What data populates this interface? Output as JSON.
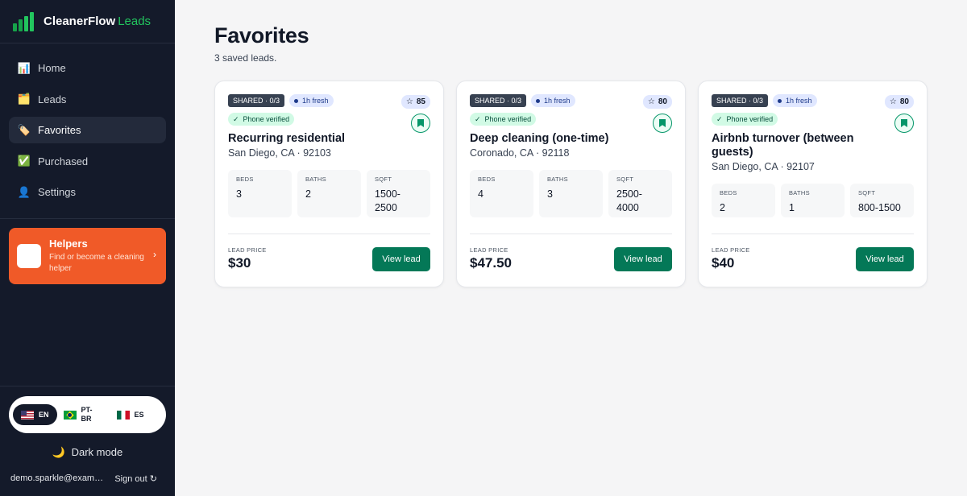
{
  "brand": {
    "name": "CleanerFlow",
    "accent": "Leads",
    "accent_color": "#22c55e"
  },
  "nav": {
    "items": [
      {
        "label": "Home",
        "icon": "chart-icon",
        "glyph": "📊"
      },
      {
        "label": "Leads",
        "icon": "box-icon",
        "glyph": "🗂️"
      },
      {
        "label": "Favorites",
        "icon": "tag-icon",
        "glyph": "🏷️",
        "active": true
      },
      {
        "label": "Purchased",
        "icon": "checkmark-icon",
        "glyph": "✅"
      },
      {
        "label": "Settings",
        "icon": "user-icon",
        "glyph": "👤"
      }
    ]
  },
  "helpers": {
    "title": "Helpers",
    "subtitle": "Find or become a cleaning helper",
    "chevron": "›",
    "bg_color": "#f05a28"
  },
  "language": {
    "options": [
      {
        "code": "EN",
        "flag": "us-flag-icon",
        "active": true
      },
      {
        "code": "PT-BR",
        "flag": "brazil-flag-icon",
        "active": false
      },
      {
        "code": "ES",
        "flag": "mexico-flag-icon",
        "active": false
      }
    ]
  },
  "dark_mode": {
    "label": "Dark mode",
    "icon": "moon-icon",
    "glyph": "🌙"
  },
  "account": {
    "email": "demo.sparkle@example.com",
    "sign_out": "Sign out",
    "sign_out_glyph": "↻"
  },
  "page": {
    "title": "Favorites",
    "subtitle": "3 saved leads."
  },
  "cards": [
    {
      "shared": "SHARED · 0/3",
      "fresh": "1h fresh",
      "score": "85",
      "verified": "Phone verified",
      "title": "Recurring residential",
      "location": "San Diego, CA · 92103",
      "beds_label": "BEDS",
      "beds": "3",
      "baths_label": "BATHS",
      "baths": "2",
      "sqft_label": "SQFT",
      "sqft": "1500-2500",
      "price_label": "LEAD PRICE",
      "price": "$30",
      "button": "View lead"
    },
    {
      "shared": "SHARED · 0/3",
      "fresh": "1h fresh",
      "score": "80",
      "verified": "Phone verified",
      "title": "Deep cleaning (one-time)",
      "location": "Coronado, CA · 92118",
      "beds_label": "BEDS",
      "beds": "4",
      "baths_label": "BATHS",
      "baths": "3",
      "sqft_label": "SQFT",
      "sqft": "2500-4000",
      "price_label": "LEAD PRICE",
      "price": "$47.50",
      "button": "View lead"
    },
    {
      "shared": "SHARED · 0/3",
      "fresh": "1h fresh",
      "score": "80",
      "verified": "Phone verified",
      "title": "Airbnb turnover (between guests)",
      "location": "San Diego, CA · 92107",
      "beds_label": "BEDS",
      "beds": "2",
      "baths_label": "BATHS",
      "baths": "1",
      "sqft_label": "SQFT",
      "sqft": "800-1500",
      "price_label": "LEAD PRICE",
      "price": "$40",
      "button": "View lead"
    }
  ],
  "colors": {
    "sidebar": "#141a2a",
    "primary_button": "#047857",
    "verified_bg": "#d1fae5"
  }
}
